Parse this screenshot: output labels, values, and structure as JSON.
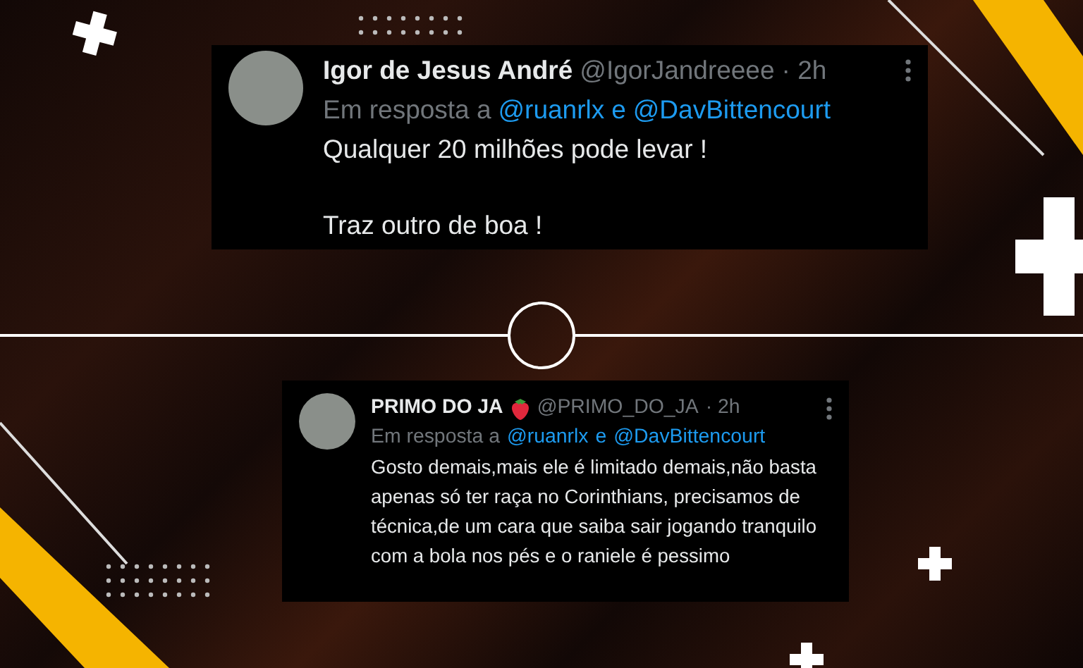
{
  "tweets": [
    {
      "name": "Igor de Jesus André",
      "emoji_badge": false,
      "handle": "@IgorJandreeee",
      "time": "· 2h",
      "reply_prefix": "Em resposta a",
      "mentions": [
        "@ruanrlx",
        "@DavBittencourt"
      ],
      "mention_joiner": "e",
      "body": [
        "Qualquer 20 milhões pode levar !",
        "Traz outro de boa !"
      ]
    },
    {
      "name": "PRIMO DO JA",
      "emoji_badge": true,
      "handle": "@PRIMO_DO_JA",
      "time": "· 2h",
      "reply_prefix": "Em resposta a",
      "mentions": [
        "@ruanrlx",
        "@DavBittencourt"
      ],
      "mention_joiner": "e",
      "body": [
        "Gosto demais,mais ele é limitado demais,não basta apenas só ter raça no Corinthians, precisamos de técnica,de um cara que saiba sair jogando tranquilo com a bola nos pés e o raniele é pessimo"
      ]
    }
  ]
}
